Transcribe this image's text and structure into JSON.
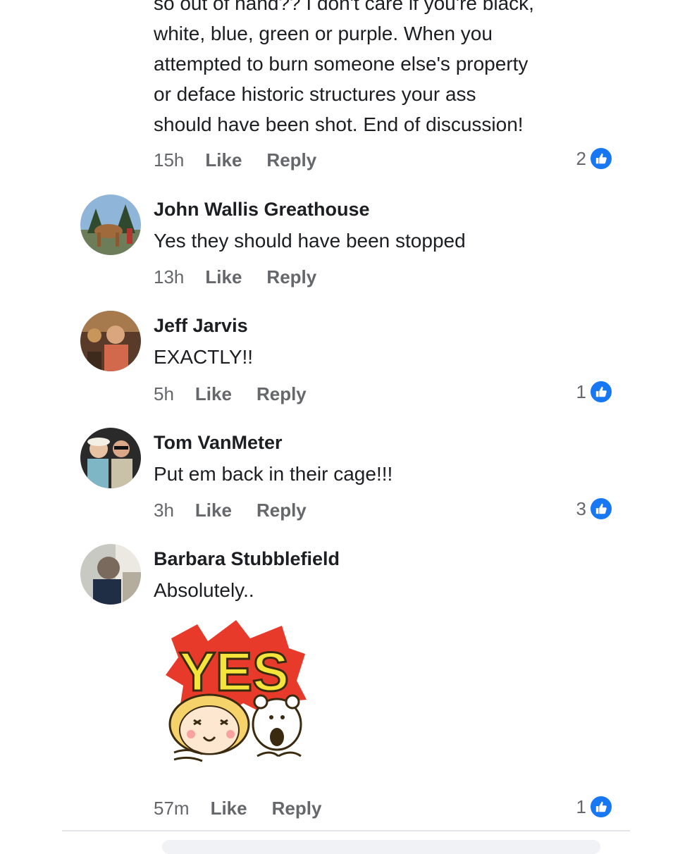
{
  "comments": [
    {
      "text": "so out of hand?? I don't care if you're black,\nwhite, blue, green or purple. When you\nattempted to burn someone else's property\nor deface historic structures your ass\nshould have been shot. End of discussion!",
      "time": "15h",
      "like": "Like",
      "reply": "Reply",
      "reactions": "2"
    },
    {
      "author": "John Wallis Greathouse",
      "text": "Yes they should have been stopped",
      "time": "13h",
      "like": "Like",
      "reply": "Reply"
    },
    {
      "author": "Jeff Jarvis",
      "text": "EXACTLY!!",
      "time": "5h",
      "like": "Like",
      "reply": "Reply",
      "reactions": "1"
    },
    {
      "author": "Tom VanMeter",
      "text": "Put em back in their cage!!!",
      "time": "3h",
      "like": "Like",
      "reply": "Reply",
      "reactions": "3"
    },
    {
      "author": "Barbara Stubblefield",
      "text": "Absolutely..",
      "sticker_text": "YES",
      "time": "57m",
      "like": "Like",
      "reply": "Reply",
      "reactions": "1"
    }
  ],
  "icons": {
    "reaction": "thumbs-up-icon"
  },
  "colors": {
    "like_blue": "#1877f2",
    "meta_gray": "#65676b",
    "text": "#1c1e21"
  }
}
